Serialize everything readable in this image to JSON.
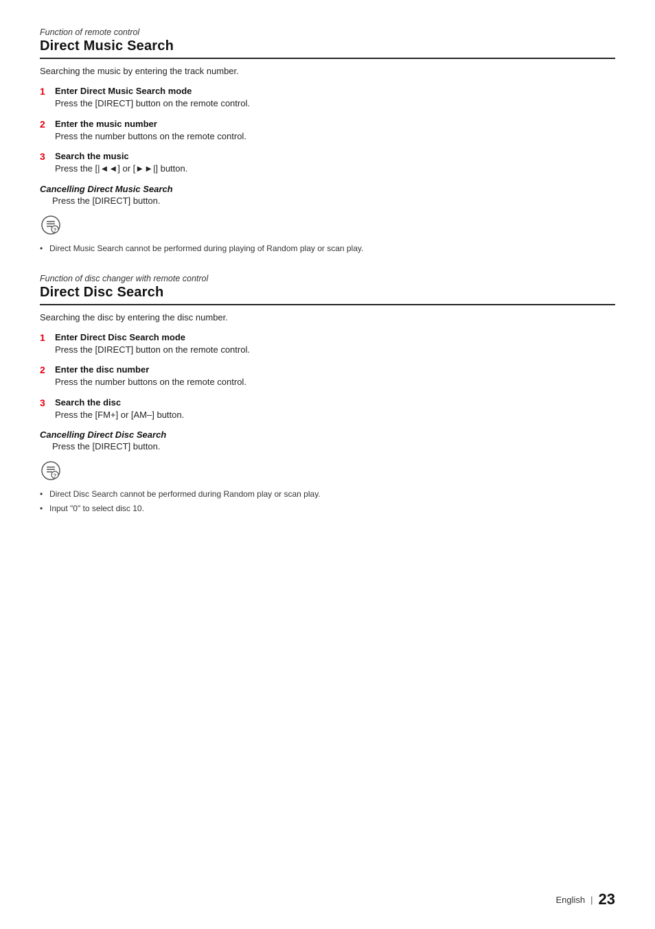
{
  "sections": [
    {
      "function_label": "Function of remote control",
      "title": "Direct Music Search",
      "intro": "Searching the music by entering the track number.",
      "steps": [
        {
          "number": "1",
          "title": "Enter Direct Music Search mode",
          "desc": "Press the [DIRECT] button on the remote control."
        },
        {
          "number": "2",
          "title": "Enter the music number",
          "desc": "Press the number buttons on the remote control."
        },
        {
          "number": "3",
          "title": "Search the music",
          "desc": "Press the [|◄◄] or [►►|] button."
        }
      ],
      "cancel_title": "Cancelling Direct Music Search",
      "cancel_desc": "Press the [DIRECT] button.",
      "notes": [
        "Direct Music Search cannot be performed during playing of Random play or scan play."
      ]
    },
    {
      "function_label": "Function of disc changer with remote control",
      "title": "Direct Disc Search",
      "intro": "Searching the disc by entering the disc number.",
      "steps": [
        {
          "number": "1",
          "title": "Enter Direct Disc Search mode",
          "desc": "Press the [DIRECT] button on the remote control."
        },
        {
          "number": "2",
          "title": "Enter the disc number",
          "desc": "Press the number buttons on the remote control."
        },
        {
          "number": "3",
          "title": "Search the disc",
          "desc": "Press the [FM+] or [AM–] button."
        }
      ],
      "cancel_title": "Cancelling Direct Disc Search",
      "cancel_desc": "Press the [DIRECT] button.",
      "notes": [
        "Direct Disc Search cannot be performed during Random play or scan play.",
        "Input \"0\" to select disc 10."
      ]
    }
  ],
  "footer": {
    "language": "English",
    "divider": "|",
    "page": "23"
  }
}
